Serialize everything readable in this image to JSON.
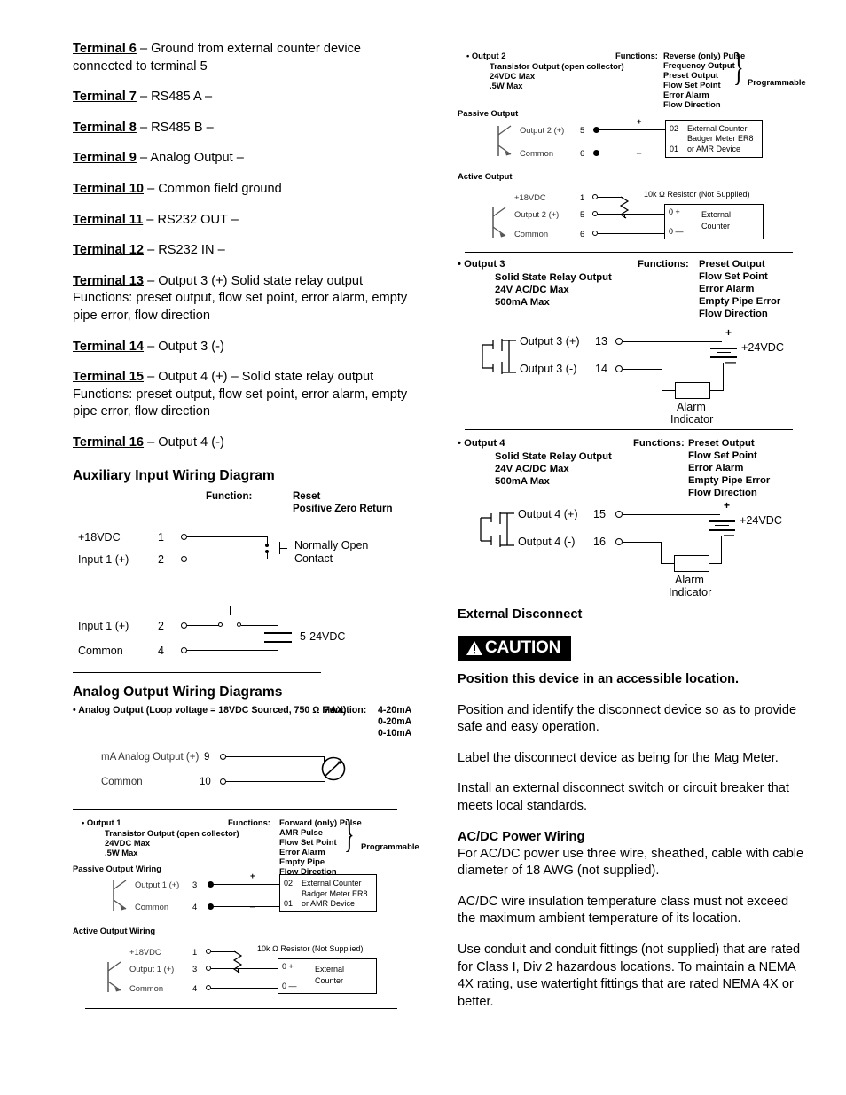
{
  "left_column": {
    "terminals": [
      {
        "label": "Terminal 6",
        "desc": " – Ground from external counter device connected to terminal 5"
      },
      {
        "label": "Terminal 7",
        "desc": " – RS485 A  –"
      },
      {
        "label": "Terminal 8",
        "desc": "  – RS485 B  –"
      },
      {
        "label": "Terminal 9",
        "desc": "  – Analog Output  –"
      },
      {
        "label": "Terminal 10",
        "desc": "  – Common field ground"
      },
      {
        "label": "Terminal 11",
        "desc": "  – RS232 OUT  –"
      },
      {
        "label": "Terminal 12",
        "desc": "  – RS232 IN  –"
      },
      {
        "label": "Terminal 13",
        "desc": "  – Output 3 (+)  Solid state relay output",
        "extra": "Functions: preset output, flow set point, error alarm, empty pipe error, flow direction"
      },
      {
        "label": "Terminal 14",
        "desc": "  – Output 3 (-)"
      },
      {
        "label": "Terminal 15",
        "desc": "  – Output 4 (+)   – Solid state relay output",
        "extra": "Functions: preset output, flow set point, error alarm, empty pipe error, flow direction"
      },
      {
        "label": "Terminal 16",
        "desc": "  – Output 4 (-)"
      }
    ],
    "aux_diagram": {
      "title": "Auxiliary Input Wiring Diagram",
      "function_label": "Function:",
      "functions": [
        "Reset",
        "Positive Zero Return"
      ],
      "row1": {
        "name": "+18VDC",
        "num": "1"
      },
      "row2": {
        "name": "Input 1 (+)",
        "num": "2"
      },
      "contact_note_line1": "Normally Open",
      "contact_note_line2": "Contact",
      "row3": {
        "name": "Input 1 (+)",
        "num": "2"
      },
      "row4": {
        "name": "Common",
        "num": "4"
      },
      "supply": "5-24VDC"
    },
    "analog_diagram": {
      "title": "Analog Output Wiring Diagrams",
      "spec": "• Analog Output (Loop voltage = 18VDC Sourced, 750 Ω MAX)",
      "function_label": "Function:",
      "functions": [
        "4-20mA",
        "0-20mA",
        "0-10mA"
      ],
      "row1": {
        "name": "mA Analog Output (+)",
        "num": "9"
      },
      "row2": {
        "name": "Common",
        "num": "10"
      }
    },
    "output1": {
      "title": "• Output 1",
      "specs": [
        "Transistor Output (open collector)",
        "24VDC Max",
        ".5W Max"
      ],
      "function_label": "Functions:",
      "functions": [
        "Forward (only) Pulse",
        "AMR Pulse",
        "Flow Set Point",
        "Error Alarm",
        "Empty Pipe",
        "Flow Direction"
      ],
      "programmable": "Programmable",
      "passive_heading": "Passive Output Wiring",
      "passive_row1": {
        "name": "Output 1 (+)",
        "num": "3"
      },
      "passive_row2": {
        "name": "Common",
        "num": "4"
      },
      "passive_plus": "+",
      "passive_minus": "_",
      "box_num_top": "02",
      "box_num_bottom": "01",
      "box_line1": "External Counter",
      "box_line2": "Badger Meter ER8",
      "box_line3": "or AMR Device",
      "active_heading": "Active Output Wiring",
      "active_row1": {
        "name": "+18VDC",
        "num": "1"
      },
      "active_row2": {
        "name": "Output 1 (+)",
        "num": "3"
      },
      "active_row3": {
        "name": "Common",
        "num": "4"
      },
      "resistor_note": "10k Ω  Resistor (Not Supplied)",
      "ext_box_plus": "0 +",
      "ext_box_minus": "0 —",
      "ext_box_line1": "External",
      "ext_box_line2": "Counter"
    }
  },
  "right_column": {
    "output2": {
      "title": "• Output 2",
      "specs": [
        "Transistor Output (open collector)",
        "24VDC Max",
        ".5W Max"
      ],
      "function_label": "Functions:",
      "functions": [
        "Reverse (only) Pulse",
        "Frequency Output",
        "Preset Output",
        "Flow Set Point",
        "Error Alarm",
        "Flow Direction"
      ],
      "programmable": "Programmable",
      "passive_heading": "Passive Output",
      "passive_row1": {
        "name": "Output 2 (+)",
        "num": "5"
      },
      "passive_row2": {
        "name": "Common",
        "num": "6"
      },
      "passive_plus": "+",
      "passive_minus": "_",
      "box_num_top": "02",
      "box_num_bottom": "01",
      "box_line1": "External Counter",
      "box_line2": "Badger Meter ER8",
      "box_line3": "or AMR Device",
      "active_heading": "Active Output",
      "active_row1": {
        "name": "+18VDC",
        "num": "1"
      },
      "active_row2": {
        "name": "Output 2 (+)",
        "num": "5"
      },
      "active_row3": {
        "name": "Common",
        "num": "6"
      },
      "resistor_note": "10k Ω  Resistor (Not Supplied)",
      "ext_box_plus": "0 +",
      "ext_box_minus": "0 —",
      "ext_box_line1": "External",
      "ext_box_line2": "Counter"
    },
    "output3": {
      "title": "• Output 3",
      "specs": [
        "Solid State Relay Output",
        "24V AC/DC Max",
        "500mA Max"
      ],
      "function_label": "Functions:",
      "functions": [
        "Preset Output",
        "Flow Set Point",
        "Error Alarm",
        "Empty Pipe Error",
        "Flow Direction"
      ],
      "row1": {
        "name": "Output 3 (+)",
        "num": "13"
      },
      "row2": {
        "name": "Output 3 (-)",
        "num": "14"
      },
      "plus": "+",
      "minus": "—",
      "supply": "+24VDC",
      "alarm_line1": "Alarm",
      "alarm_line2": "Indicator"
    },
    "output4": {
      "title": "• Output 4",
      "specs": [
        "Solid State Relay Output",
        "24V AC/DC Max",
        "500mA Max"
      ],
      "function_label": "Functions:",
      "functions": [
        "Preset Output",
        "Flow Set Point",
        "Error Alarm",
        "Empty Pipe Error",
        "Flow Direction"
      ],
      "row1": {
        "name": "Output 4 (+)",
        "num": "15"
      },
      "row2": {
        "name": "Output 4 (-)",
        "num": "16"
      },
      "plus": "+",
      "minus": "—",
      "supply": "+24VDC",
      "alarm_line1": "Alarm",
      "alarm_line2": "Indicator"
    },
    "external_disconnect": {
      "heading": "External Disconnect",
      "caution_label": "CAUTION",
      "bold_line": "Position this device in an accessible location.",
      "p1": "Position and identify the disconnect device so as to provide safe and easy operation.",
      "p2": "Label the disconnect device as being for the Mag Meter.",
      "p3": "Install an external disconnect switch or circuit breaker that meets local standards."
    },
    "ac_dc": {
      "heading": "AC/DC Power Wiring",
      "p1": "For AC/DC power use three wire, sheathed, cable with cable diameter of 18 AWG (not supplied).",
      "p2": "AC/DC wire insulation temperature class must not exceed the maximum ambient temperature of its location.",
      "p3": "Use conduit and conduit fittings (not supplied) that are rated for Class I, Div 2 hazardous locations. To maintain a NEMA 4X rating, use watertight fittings that are rated NEMA 4X or better."
    }
  }
}
